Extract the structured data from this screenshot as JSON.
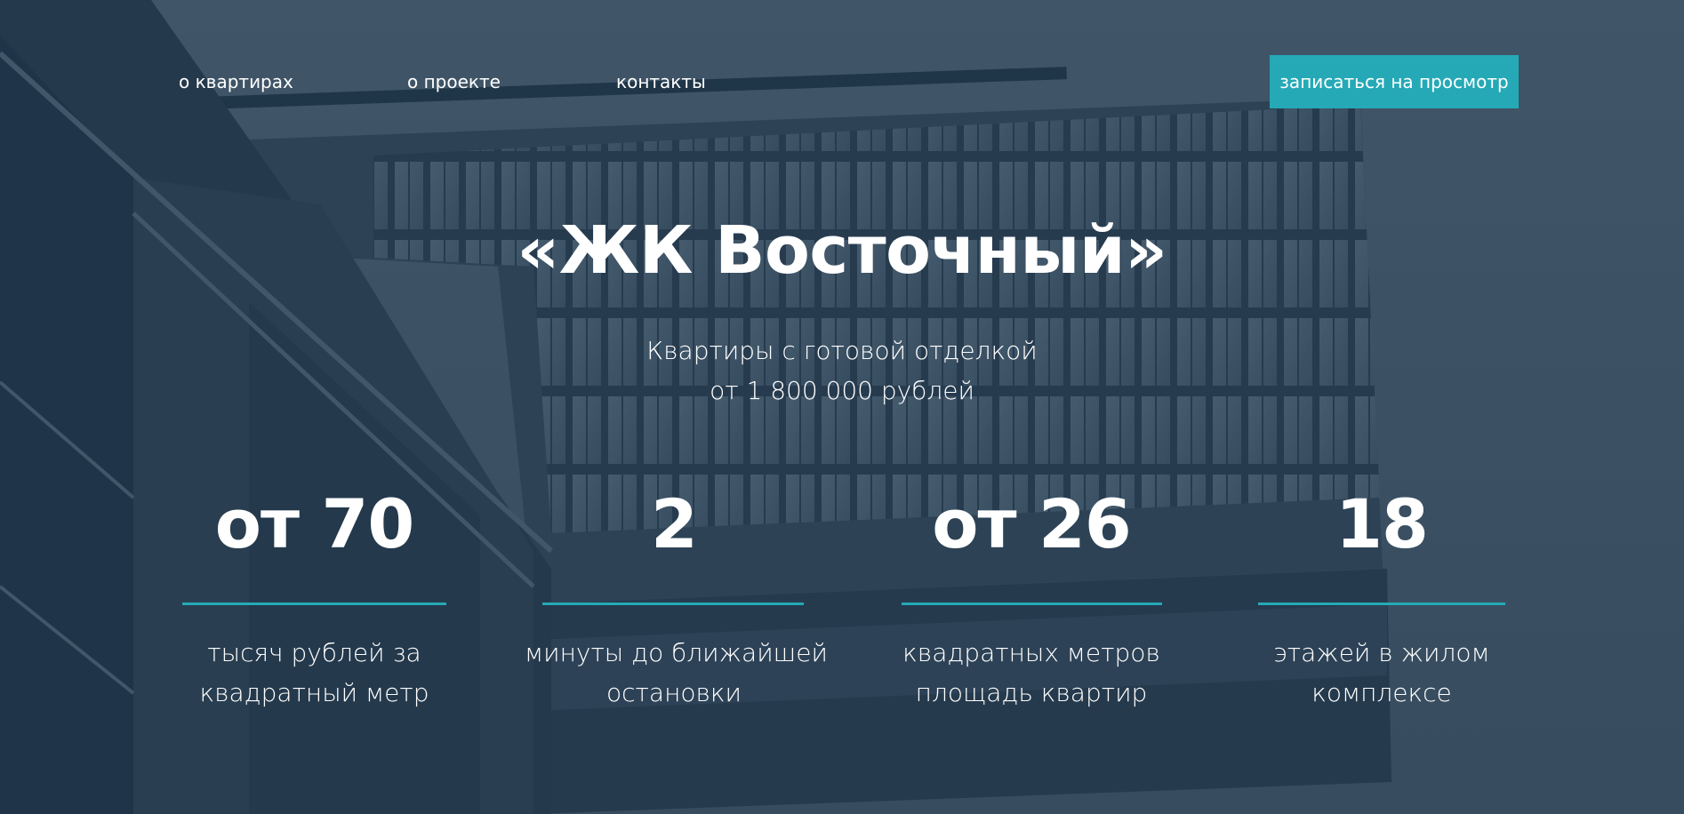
{
  "nav": {
    "links": [
      {
        "label": "о квартирах"
      },
      {
        "label": "о проекте"
      },
      {
        "label": "контакты"
      }
    ],
    "cta_label": "записаться на просмотр"
  },
  "hero": {
    "title": "«ЖК Восточный»",
    "subtitle_line1": "Квартиры с готовой отделкой",
    "subtitle_line2": "от 1 800 000 рублей"
  },
  "stats": [
    {
      "value": "от 70",
      "label_line1": "тысяч рублей за",
      "label_line2": "квадратный метр"
    },
    {
      "value": "2",
      "label_line1": "минуты до ближайшей",
      "label_line2": "остановки"
    },
    {
      "value": "от 26",
      "label_line1": "квадратных метров",
      "label_line2": "площадь квартир"
    },
    {
      "value": "18",
      "label_line1": "этажей в жилом",
      "label_line2": "комплексе"
    }
  ],
  "colors": {
    "accent": "#25a9b6",
    "overlay": "#1c3244",
    "text": "#ffffff"
  },
  "background": {
    "image": "building-facade-photo"
  }
}
